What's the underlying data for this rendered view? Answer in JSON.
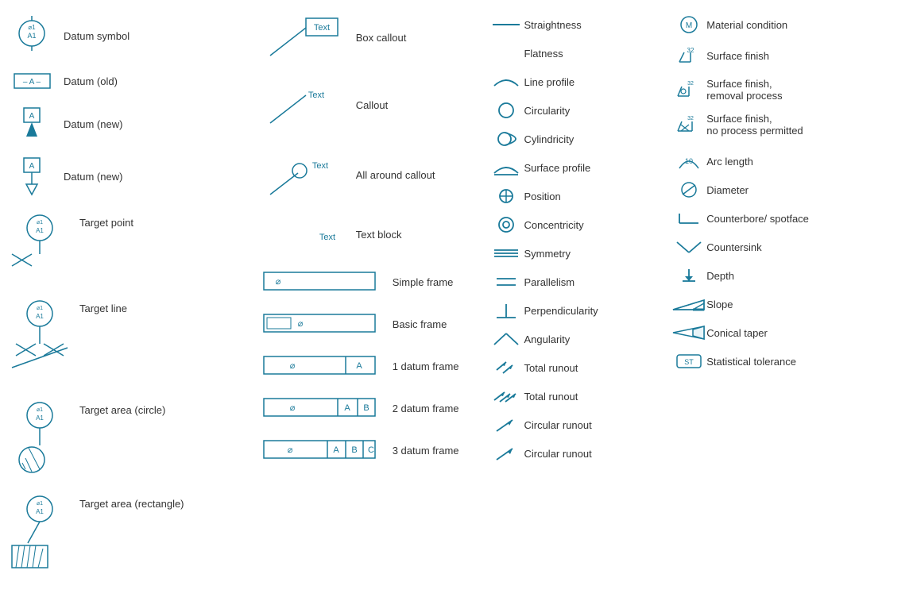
{
  "col1": {
    "items": [
      {
        "id": "datum-symbol",
        "label": "Datum symbol"
      },
      {
        "id": "datum-old",
        "label": "Datum (old)"
      },
      {
        "id": "datum-new-1",
        "label": "Datum (new)"
      },
      {
        "id": "datum-new-2",
        "label": "Datum (new)"
      },
      {
        "id": "target-point",
        "label": "Target point"
      },
      {
        "id": "target-line",
        "label": "Target line"
      },
      {
        "id": "target-area-circle",
        "label": "Target area (circle)"
      },
      {
        "id": "target-area-rect",
        "label": "Target area (rectangle)"
      }
    ]
  },
  "col2": {
    "callouts": [
      {
        "id": "box-callout",
        "label": "Box callout"
      },
      {
        "id": "callout",
        "label": "Callout"
      },
      {
        "id": "all-around-callout",
        "label": "All around callout"
      },
      {
        "id": "text-block",
        "label": "Text block"
      }
    ],
    "frames": [
      {
        "id": "simple-frame",
        "label": "Simple frame"
      },
      {
        "id": "basic-frame",
        "label": "Basic frame"
      },
      {
        "id": "one-datum-frame",
        "label": "1 datum frame"
      },
      {
        "id": "two-datum-frame",
        "label": "2 datum frame"
      },
      {
        "id": "three-datum-frame",
        "label": "3 datum frame"
      }
    ]
  },
  "col3": {
    "items": [
      {
        "id": "straightness",
        "label": "Straightness"
      },
      {
        "id": "flatness",
        "label": "Flatness"
      },
      {
        "id": "line-profile",
        "label": "Line profile"
      },
      {
        "id": "circularity",
        "label": "Circularity"
      },
      {
        "id": "cylindricity",
        "label": "Cylindricity"
      },
      {
        "id": "surface-profile",
        "label": "Surface profile"
      },
      {
        "id": "position",
        "label": "Position"
      },
      {
        "id": "concentricity",
        "label": "Concentricity"
      },
      {
        "id": "symmetry",
        "label": "Symmetry"
      },
      {
        "id": "parallelism",
        "label": "Parallelism"
      },
      {
        "id": "perpendicularity",
        "label": "Perpendicularity"
      },
      {
        "id": "angularity",
        "label": "Angularity"
      },
      {
        "id": "total-runout-1",
        "label": "Total runout"
      },
      {
        "id": "total-runout-2",
        "label": "Total runout"
      },
      {
        "id": "circular-runout-1",
        "label": "Circular runout"
      },
      {
        "id": "circular-runout-2",
        "label": "Circular runout"
      }
    ]
  },
  "col4": {
    "items": [
      {
        "id": "material-condition",
        "label": "Material condition"
      },
      {
        "id": "surface-finish",
        "label": "Surface finish"
      },
      {
        "id": "surface-finish-removal",
        "label": "Surface finish,\nremoval process"
      },
      {
        "id": "surface-finish-no-process",
        "label": "Surface finish,\nno process permitted"
      },
      {
        "id": "arc-length",
        "label": "Arc length"
      },
      {
        "id": "diameter",
        "label": "Diameter"
      },
      {
        "id": "counterbore-spotface",
        "label": "Counterbore/ spotface"
      },
      {
        "id": "countersink",
        "label": "Countersink"
      },
      {
        "id": "depth",
        "label": "Depth"
      },
      {
        "id": "slope",
        "label": "Slope"
      },
      {
        "id": "conical-taper",
        "label": "Conical taper"
      },
      {
        "id": "statistical-tolerance",
        "label": "Statistical tolerance"
      }
    ]
  }
}
